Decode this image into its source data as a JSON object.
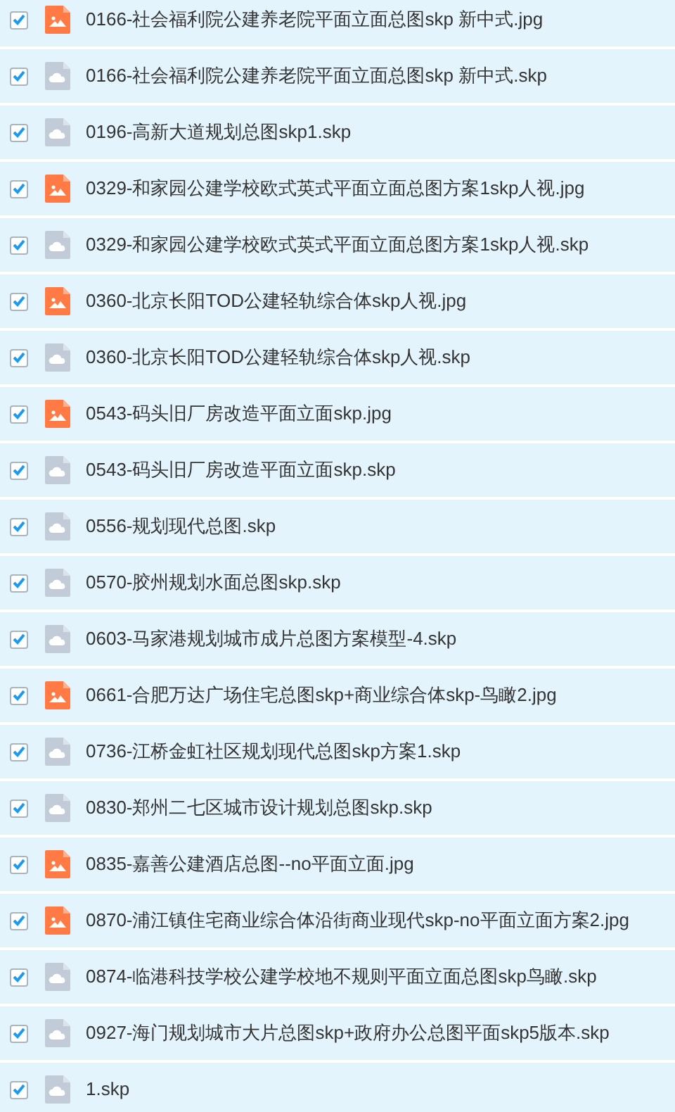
{
  "files": [
    {
      "name": "0166-社会福利院公建养老院平面立面总图skp 新中式.jpg",
      "kind": "image",
      "checked": true
    },
    {
      "name": "0166-社会福利院公建养老院平面立面总图skp 新中式.skp",
      "kind": "cloud",
      "checked": true
    },
    {
      "name": "0196-高新大道规划总图skp1.skp",
      "kind": "cloud",
      "checked": true
    },
    {
      "name": "0329-和家园公建学校欧式英式平面立面总图方案1skp人视.jpg",
      "kind": "image",
      "checked": true
    },
    {
      "name": "0329-和家园公建学校欧式英式平面立面总图方案1skp人视.skp",
      "kind": "cloud",
      "checked": true
    },
    {
      "name": "0360-北京长阳TOD公建轻轨综合体skp人视.jpg",
      "kind": "image",
      "checked": true
    },
    {
      "name": "0360-北京长阳TOD公建轻轨综合体skp人视.skp",
      "kind": "cloud",
      "checked": true
    },
    {
      "name": "0543-码头旧厂房改造平面立面skp.jpg",
      "kind": "image",
      "checked": true
    },
    {
      "name": "0543-码头旧厂房改造平面立面skp.skp",
      "kind": "cloud",
      "checked": true
    },
    {
      "name": "0556-规划现代总图.skp",
      "kind": "cloud",
      "checked": true
    },
    {
      "name": "0570-胶州规划水面总图skp.skp",
      "kind": "cloud",
      "checked": true
    },
    {
      "name": "0603-马家港规划城市成片总图方案模型-4.skp",
      "kind": "cloud",
      "checked": true
    },
    {
      "name": "0661-合肥万达广场住宅总图skp+商业综合体skp-鸟瞰2.jpg",
      "kind": "image",
      "checked": true
    },
    {
      "name": "0736-江桥金虹社区规划现代总图skp方案1.skp",
      "kind": "cloud",
      "checked": true
    },
    {
      "name": "0830-郑州二七区城市设计规划总图skp.skp",
      "kind": "cloud",
      "checked": true
    },
    {
      "name": "0835-嘉善公建酒店总图--no平面立面.jpg",
      "kind": "image",
      "checked": true
    },
    {
      "name": "0870-浦江镇住宅商业综合体沿街商业现代skp-no平面立面方案2.jpg",
      "kind": "image",
      "checked": true
    },
    {
      "name": "0874-临港科技学校公建学校地不规则平面立面总图skp鸟瞰.skp",
      "kind": "cloud",
      "checked": true
    },
    {
      "name": "0927-海门规划城市大片总图skp+政府办公总图平面skp5版本.skp",
      "kind": "cloud",
      "checked": true
    },
    {
      "name": "1.skp",
      "kind": "cloud",
      "checked": true
    }
  ]
}
